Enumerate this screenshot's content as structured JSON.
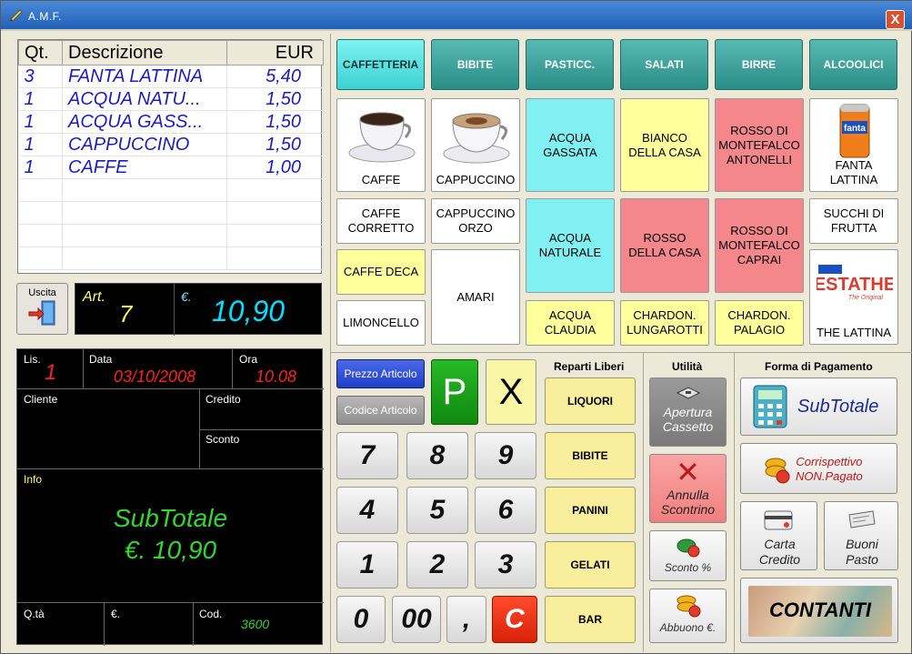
{
  "window": {
    "title": "A.M.F.",
    "close_label": "X"
  },
  "order": {
    "headers": [
      "Qt.",
      "Descrizione",
      "EUR"
    ],
    "rows": [
      {
        "qty": "3",
        "desc": "FANTA LATTINA",
        "eur": "5,40"
      },
      {
        "qty": "1",
        "desc": "ACQUA NATU...",
        "eur": "1,50"
      },
      {
        "qty": "1",
        "desc": "ACQUA GASS...",
        "eur": "1,50"
      },
      {
        "qty": "1",
        "desc": "CAPPUCCINO",
        "eur": "1,50"
      },
      {
        "qty": "1",
        "desc": "CAFFE",
        "eur": "1,00"
      }
    ]
  },
  "exit": {
    "label": "Uscita"
  },
  "counters": {
    "art_label": "Art.",
    "art_value": "7",
    "euro_label": "€.",
    "euro_value": "10,90"
  },
  "info": {
    "lis_label": "Lis.",
    "lis_value": "1",
    "data_label": "Data",
    "data_value": "03/10/2008",
    "ora_label": "Ora",
    "ora_value": "10.08",
    "cliente_label": "Cliente",
    "credito_label": "Credito",
    "sconto_label": "Sconto",
    "info_label": "Info",
    "subtotal_line1": "SubTotale",
    "subtotal_line2": "€.  10,90",
    "qta_label": "Q.tà",
    "euro_label": "€.",
    "cod_label": "Cod.",
    "cod_value": "3600"
  },
  "categories": [
    "CAFFETTERIA",
    "BIBITE",
    "PASTICC.",
    "SALATI",
    "BIRRE",
    "ALCOOLICI"
  ],
  "products": {
    "caffe": "CAFFE",
    "cappuccino": "CAPPUCCINO",
    "acqua_gassata": "ACQUA\nGASSATA",
    "bianco_casa": "BIANCO\nDELLA CASA",
    "rosso_antonelli": "ROSSO DI\nMONTEFALCO\nANTONELLI",
    "fanta": "FANTA\nLATTINA",
    "caffe_corretto": "CAFFE\nCORRETTO",
    "cappuccino_orzo": "CAPPUCCINO\nORZO",
    "acqua_naturale": "ACQUA\nNATURALE",
    "rosso_casa": "ROSSO\nDELLA CASA",
    "rosso_caprai": "ROSSO DI\nMONTEFALCO\nCAPRAI",
    "succhi": "SUCCHI DI\nFRUTTA",
    "caffe_deca": "CAFFE DECA",
    "amari": "AMARI",
    "the_lattina": "THE LATTINA",
    "limoncello": "LIMONCELLO",
    "acqua_claudia": "ACQUA\nCLAUDIA",
    "chardon_lungarotti": "CHARDON.\nLUNGAROTTI",
    "chardon_palagio": "CHARDON.\nPALAGIO",
    "fanta_can_text": "fanta",
    "estathe_text": "ESTATHE",
    "estathe_sub": "The Original"
  },
  "keypad": {
    "prezzo": "Prezzo Articolo",
    "codice": "Codice Articolo",
    "p": "P",
    "x": "X",
    "digits": [
      "7",
      "8",
      "9",
      "4",
      "5",
      "6",
      "1",
      "2",
      "3"
    ],
    "zero": "0",
    "double_zero": "00",
    "comma": ",",
    "clear": "C"
  },
  "reparti": {
    "title": "Reparti Liberi",
    "items": [
      "LIQUORI",
      "BIBITE",
      "PANINI",
      "GELATI",
      "BAR"
    ]
  },
  "utilita": {
    "title": "Utilità",
    "apertura": "Apertura\nCassetto",
    "annulla": "Annulla\nScontrino",
    "sconto": "Sconto %",
    "abbuono": "Abbuono €."
  },
  "pagamento": {
    "title": "Forma di Pagamento",
    "subtotale": "SubTotale",
    "corrispettivo": "Corrispettivo\nNON.Pagato",
    "carta": "Carta\nCredito",
    "buoni": "Buoni\nPasto",
    "contanti": "CONTANTI"
  }
}
